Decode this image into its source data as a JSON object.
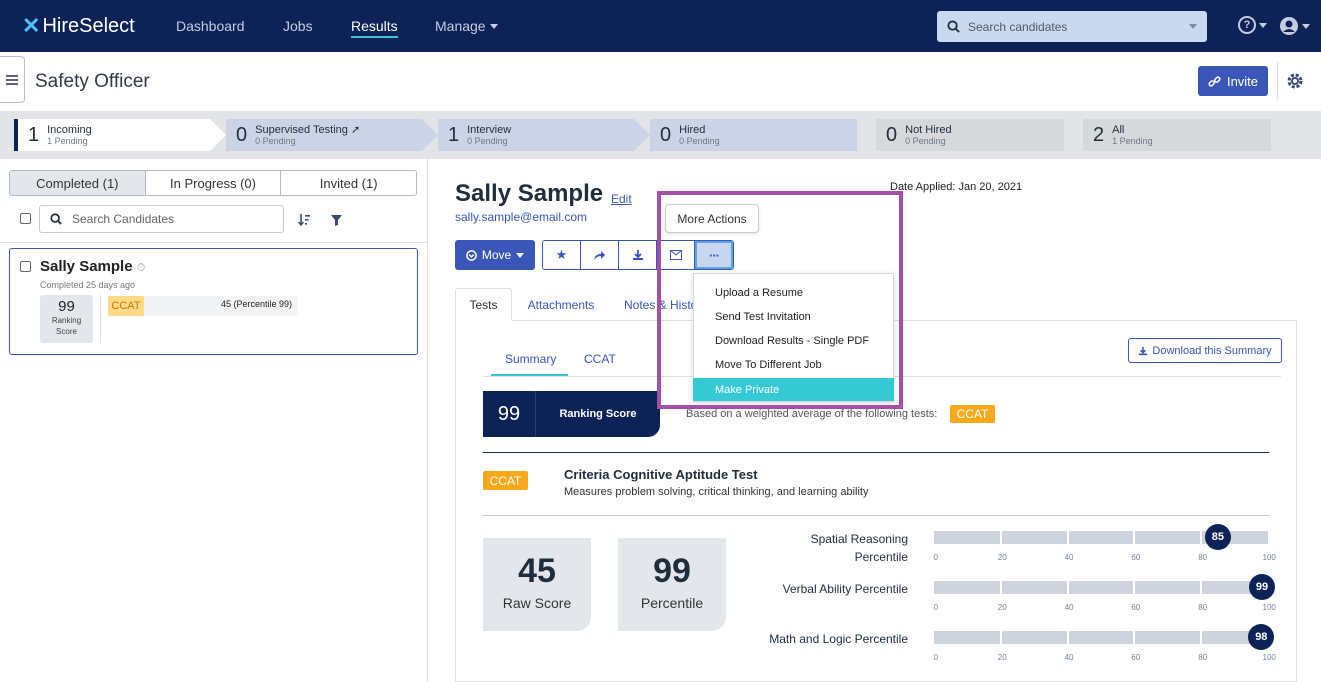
{
  "nav": {
    "logo": "HireSelect",
    "links": [
      "Dashboard",
      "Jobs",
      "Results",
      "Manage"
    ],
    "search_placeholder": "Search candidates"
  },
  "header": {
    "title": "Safety Officer",
    "invite_label": "Invite"
  },
  "pipeline": [
    {
      "count": "1",
      "label": "Incoming",
      "sub": "1 Pending"
    },
    {
      "count": "0",
      "label": "Supervised Testing",
      "sub": "0 Pending"
    },
    {
      "count": "1",
      "label": "Interview",
      "sub": "0 Pending"
    },
    {
      "count": "0",
      "label": "Hired",
      "sub": "0 Pending"
    },
    {
      "count": "0",
      "label": "Not Hired",
      "sub": "0 Pending"
    },
    {
      "count": "2",
      "label": "All",
      "sub": "1 Pending"
    }
  ],
  "left": {
    "tabs": [
      "Completed (1)",
      "In Progress (0)",
      "Invited (1)"
    ],
    "search_placeholder": "Search Candidates",
    "card": {
      "name": "Sally Sample",
      "completed": "Completed 25 days ago",
      "rank_value": "99",
      "rank_label_1": "Ranking",
      "rank_label_2": "Score",
      "test_tag": "CCAT",
      "test_result": "45 (Percentile 99)"
    }
  },
  "candidate": {
    "name": "Sally Sample",
    "edit": "Edit",
    "email": "sally.sample@email.com",
    "date_applied": "Date Applied: Jan 20, 2021",
    "move_label": "Move"
  },
  "more_actions": {
    "tooltip": "More Actions",
    "items": [
      "Upload a Resume",
      "Send Test Invitation",
      "Download Results - Single PDF",
      "Move To Different Job",
      "Make Private"
    ]
  },
  "content_tabs": [
    "Tests",
    "Attachments",
    "Notes & History"
  ],
  "sub_tabs": [
    "Summary",
    "CCAT"
  ],
  "download_summary": "Download this Summary",
  "ranking": {
    "value": "99",
    "label": "Ranking Score",
    "weighted_text": "Based on a weighted average of the following tests:",
    "tag": "CCAT"
  },
  "test": {
    "tag": "CCAT",
    "title": "Criteria Cognitive Aptitude Test",
    "desc": "Measures problem solving, critical thinking, and learning ability",
    "raw_score": "45",
    "raw_label": "Raw Score",
    "percentile": "99",
    "percentile_label": "Percentile"
  },
  "percentiles": [
    {
      "label_1": "Spatial Reasoning",
      "label_2": "Percentile",
      "value": 85
    },
    {
      "label_1": "Verbal Ability Percentile",
      "label_2": "",
      "value": 99
    },
    {
      "label_1": "Math and Logic Percentile",
      "label_2": "",
      "value": 98
    }
  ],
  "tick_labels": [
    "0",
    "20",
    "40",
    "60",
    "80",
    "100"
  ],
  "colors": {
    "navy": "#0d2357",
    "accent": "#3a56b8",
    "teal": "#35c9d3",
    "ccat": "#f7a81b",
    "highlight": "#a44fa8"
  }
}
